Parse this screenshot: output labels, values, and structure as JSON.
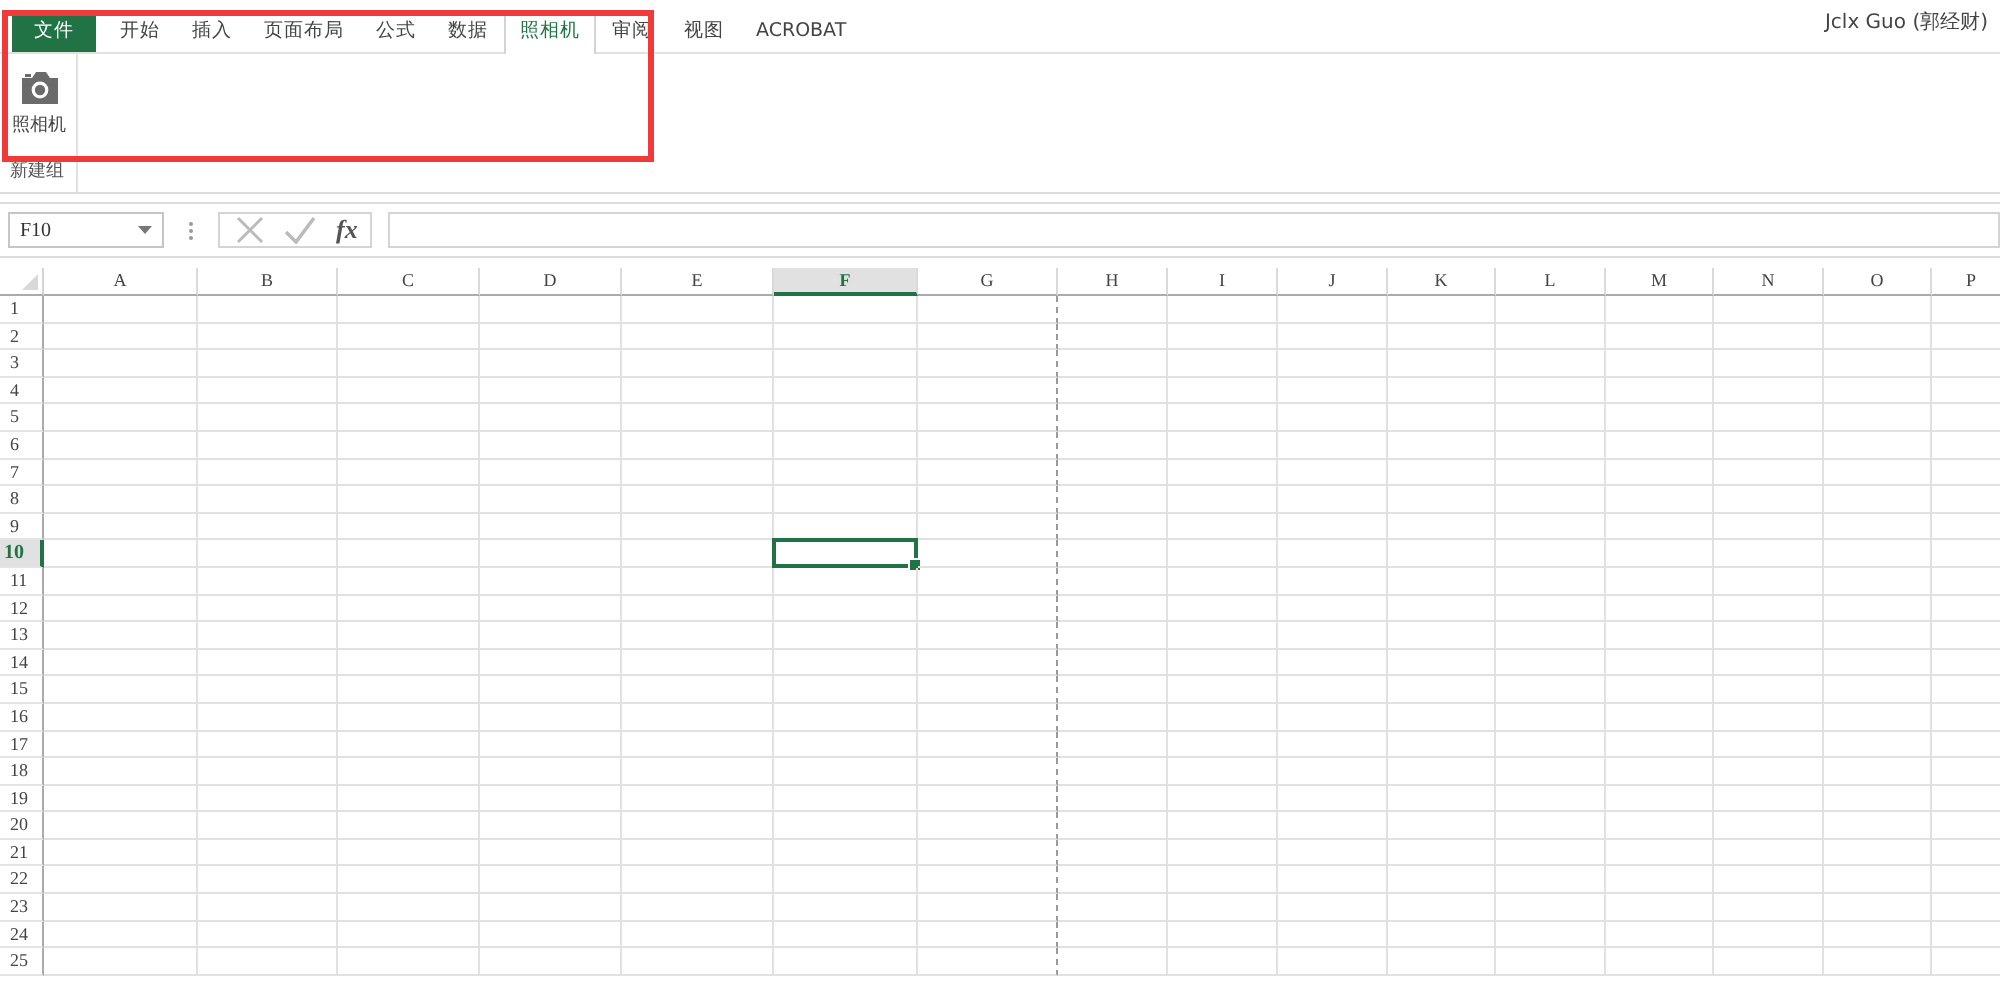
{
  "tabs": [
    {
      "label": "文件",
      "kind": "file",
      "selected": false
    },
    {
      "label": "开始",
      "kind": "tab",
      "selected": false
    },
    {
      "label": "插入",
      "kind": "tab",
      "selected": false
    },
    {
      "label": "页面布局",
      "kind": "tab",
      "selected": false
    },
    {
      "label": "公式",
      "kind": "tab",
      "selected": false
    },
    {
      "label": "数据",
      "kind": "tab",
      "selected": false
    },
    {
      "label": "照相机",
      "kind": "tab",
      "selected": true
    },
    {
      "label": "审阅",
      "kind": "tab",
      "selected": false
    },
    {
      "label": "视图",
      "kind": "tab",
      "selected": false
    },
    {
      "label": "ACROBAT",
      "kind": "tab",
      "selected": false
    }
  ],
  "user": "Jclx Guo (郭经财)",
  "ribbon": {
    "buttons": [
      {
        "label": "照相机",
        "kind": "camera"
      }
    ],
    "group_label": "新建组"
  },
  "annotation": {
    "kind": "highlight-frame",
    "color": "#f03a3a"
  },
  "formula_bar": {
    "name_box": "F10",
    "fx": "fx"
  },
  "columns": [
    {
      "label": "A",
      "selected": false,
      "page_break": false
    },
    {
      "label": "B",
      "selected": false,
      "page_break": false
    },
    {
      "label": "C",
      "selected": false,
      "page_break": false
    },
    {
      "label": "D",
      "selected": false,
      "page_break": false
    },
    {
      "label": "E",
      "selected": false,
      "page_break": false
    },
    {
      "label": "F",
      "selected": true,
      "page_break": false
    },
    {
      "label": "G",
      "selected": false,
      "page_break": true
    },
    {
      "label": "H",
      "selected": false,
      "page_break": false
    },
    {
      "label": "I",
      "selected": false,
      "page_break": false
    },
    {
      "label": "J",
      "selected": false,
      "page_break": false
    },
    {
      "label": "K",
      "selected": false,
      "page_break": false
    },
    {
      "label": "L",
      "selected": false,
      "page_break": false
    },
    {
      "label": "M",
      "selected": false,
      "page_break": false
    },
    {
      "label": "N",
      "selected": false,
      "page_break": false
    },
    {
      "label": "O",
      "selected": false,
      "page_break": false
    },
    {
      "label": "P",
      "selected": false,
      "page_break": false
    }
  ],
  "rows": [
    {
      "label": "1",
      "selected": false
    },
    {
      "label": "2",
      "selected": false
    },
    {
      "label": "3",
      "selected": false
    },
    {
      "label": "4",
      "selected": false
    },
    {
      "label": "5",
      "selected": false
    },
    {
      "label": "6",
      "selected": false
    },
    {
      "label": "7",
      "selected": false
    },
    {
      "label": "8",
      "selected": false
    },
    {
      "label": "9",
      "selected": false
    },
    {
      "label": "10",
      "selected": true
    },
    {
      "label": "11",
      "selected": false
    },
    {
      "label": "12",
      "selected": false
    },
    {
      "label": "13",
      "selected": false
    },
    {
      "label": "14",
      "selected": false
    },
    {
      "label": "15",
      "selected": false
    },
    {
      "label": "16",
      "selected": false
    },
    {
      "label": "17",
      "selected": false
    },
    {
      "label": "18",
      "selected": false
    },
    {
      "label": "19",
      "selected": false
    },
    {
      "label": "20",
      "selected": false
    },
    {
      "label": "21",
      "selected": false
    },
    {
      "label": "22",
      "selected": false
    },
    {
      "label": "23",
      "selected": false
    },
    {
      "label": "24",
      "selected": false
    },
    {
      "label": "25",
      "selected": false
    }
  ]
}
